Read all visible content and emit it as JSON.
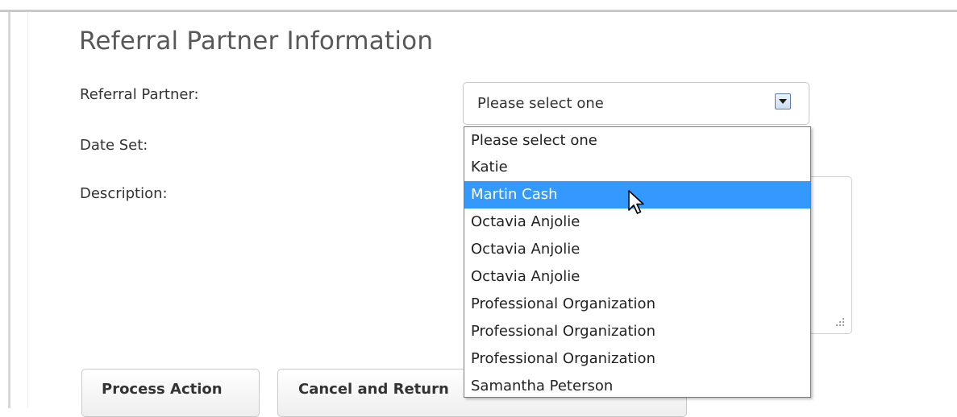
{
  "section": {
    "title": "Referral Partner Information"
  },
  "form": {
    "referral_partner_label": "Referral Partner:",
    "date_set_label": "Date Set:",
    "description_label": "Description:",
    "referral_partner_value": "Please select one"
  },
  "dropdown": {
    "options": [
      "Please select one",
      "Katie",
      "Martin Cash",
      "Octavia Anjolie",
      "Octavia Anjolie",
      "Octavia Anjolie",
      "Professional Organization",
      "Professional Organization",
      "Professional Organization",
      "Samantha Peterson"
    ],
    "highlighted": "Martin Cash"
  },
  "actions": {
    "process_label": "Process Action",
    "cancel_label": "Cancel and Return"
  },
  "colors": {
    "highlight": "#3399ff",
    "select_arrow_border": "#5c7fb3"
  },
  "icons": {
    "select_arrow": "chevron-down-icon",
    "pointer": "mouse-pointer-icon",
    "resize": "resize-grip-icon"
  }
}
